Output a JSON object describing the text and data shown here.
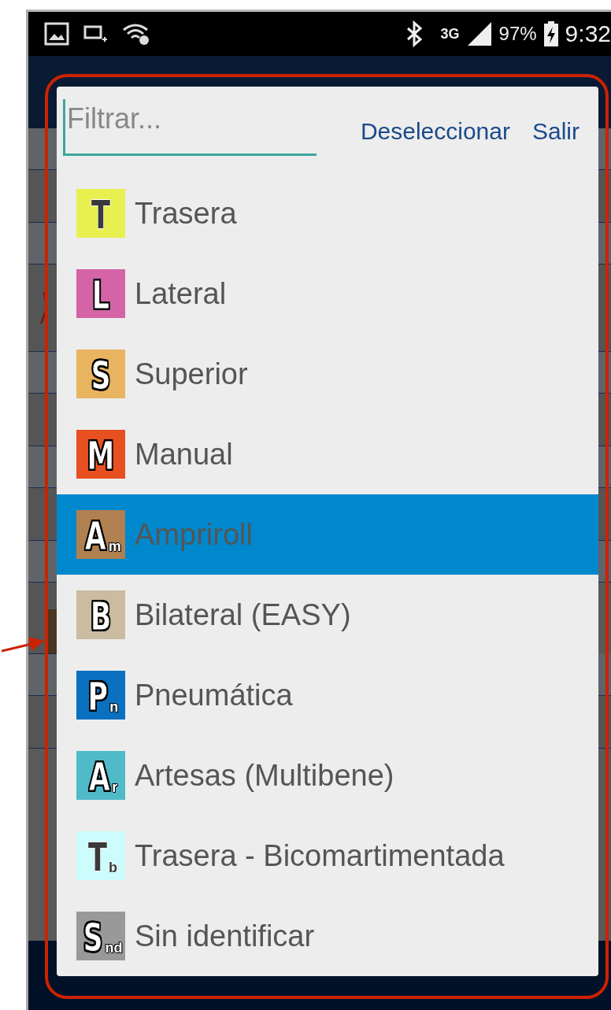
{
  "status_bar": {
    "network": "3G",
    "battery": "97%",
    "time": "9:32"
  },
  "dialog": {
    "filter": {
      "placeholder": "Filtrar..."
    },
    "buttons": [
      "Deseleccionar",
      "Salir"
    ],
    "items": [
      {
        "label": "Trasera",
        "letter": "T",
        "color": "#e8f050",
        "selected": false
      },
      {
        "label": "Lateral",
        "letter": "L",
        "color": "#d464a6",
        "selected": false
      },
      {
        "label": "Superior",
        "letter": "S",
        "color": "#e8b460",
        "selected": false
      },
      {
        "label": "Manual",
        "letter": "M",
        "color": "#e85020",
        "selected": false
      },
      {
        "label": "Ampriroll",
        "letter": "A",
        "sub": "m",
        "color": "#b08050",
        "selected": true
      },
      {
        "label": "Bilateral (EASY)",
        "letter": "B",
        "color": "#cbbba0",
        "selected": false
      },
      {
        "label": "Pneumática",
        "letter": "P",
        "sub": "n",
        "color": "#0a70c0",
        "selected": false
      },
      {
        "label": "Artesas (Multibene)",
        "letter": "A",
        "sub": "r",
        "color": "#50bac8",
        "selected": false
      },
      {
        "label": "Trasera - Bicomartimentada",
        "letter": "T",
        "sub": "b",
        "color": "#ccfcfc",
        "selected": false
      },
      {
        "label": "Sin identificar",
        "letter": "S",
        "sub": "nd",
        "color": "#999999",
        "selected": false
      }
    ]
  }
}
